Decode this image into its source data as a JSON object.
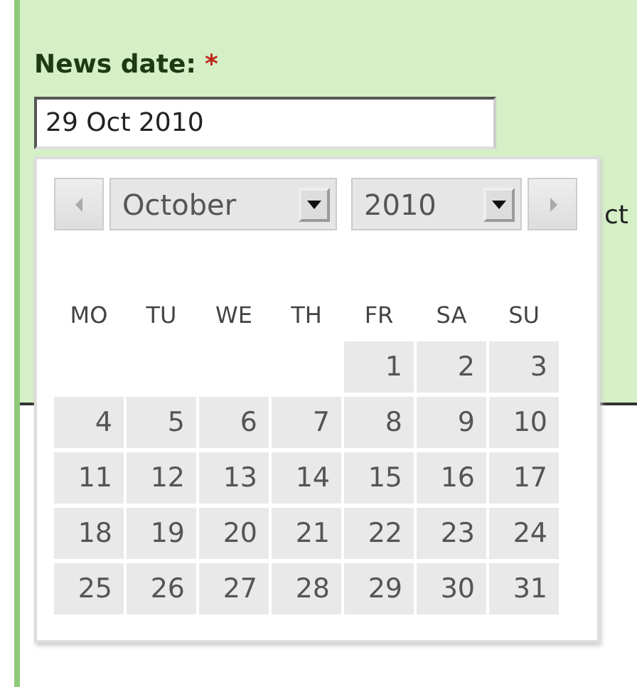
{
  "field": {
    "label": "News date:",
    "required_mark": "*",
    "value": "29 Oct 2010"
  },
  "behind_text": "ct",
  "calendar": {
    "month": "October",
    "year": "2010",
    "weekdays": [
      "MO",
      "TU",
      "WE",
      "TH",
      "FR",
      "SA",
      "SU"
    ],
    "weeks": [
      [
        {
          "kind": "blank"
        },
        {
          "kind": "blank"
        },
        {
          "kind": "blank"
        },
        {
          "kind": "blank"
        },
        {
          "kind": "day",
          "text": "1"
        },
        {
          "kind": "day",
          "text": "2"
        },
        {
          "kind": "day",
          "text": "3"
        }
      ],
      [
        {
          "kind": "day",
          "text": "4"
        },
        {
          "kind": "day",
          "text": "5"
        },
        {
          "kind": "day",
          "text": "6"
        },
        {
          "kind": "day",
          "text": "7"
        },
        {
          "kind": "day",
          "text": "8"
        },
        {
          "kind": "day",
          "text": "9"
        },
        {
          "kind": "day",
          "text": "10"
        }
      ],
      [
        {
          "kind": "day",
          "text": "11"
        },
        {
          "kind": "day",
          "text": "12"
        },
        {
          "kind": "day",
          "text": "13"
        },
        {
          "kind": "day",
          "text": "14"
        },
        {
          "kind": "day",
          "text": "15"
        },
        {
          "kind": "day",
          "text": "16"
        },
        {
          "kind": "day",
          "text": "17"
        }
      ],
      [
        {
          "kind": "day",
          "text": "18"
        },
        {
          "kind": "day",
          "text": "19"
        },
        {
          "kind": "day",
          "text": "20"
        },
        {
          "kind": "day",
          "text": "21"
        },
        {
          "kind": "day",
          "text": "22"
        },
        {
          "kind": "day",
          "text": "23"
        },
        {
          "kind": "day",
          "text": "24"
        }
      ],
      [
        {
          "kind": "day",
          "text": "25"
        },
        {
          "kind": "day",
          "text": "26"
        },
        {
          "kind": "day",
          "text": "27"
        },
        {
          "kind": "day",
          "text": "28"
        },
        {
          "kind": "day",
          "text": "29"
        },
        {
          "kind": "day",
          "text": "30"
        },
        {
          "kind": "day",
          "text": "31"
        }
      ]
    ]
  }
}
